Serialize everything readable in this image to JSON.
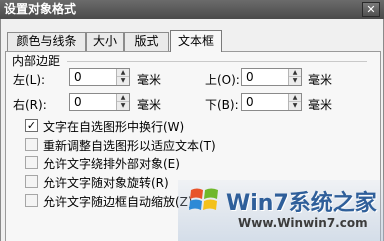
{
  "window": {
    "title": "设置对象格式",
    "close_glyph": "✕"
  },
  "tabs": [
    {
      "label": "颜色与线条",
      "active": false
    },
    {
      "label": "大小",
      "active": false
    },
    {
      "label": "版式",
      "active": false
    },
    {
      "label": "文本框",
      "active": true
    }
  ],
  "internal_margin": {
    "section_title": "内部边距",
    "left": {
      "label": "左(L):",
      "value": "0",
      "unit": "毫米"
    },
    "right": {
      "label": "右(R):",
      "value": "0",
      "unit": "毫米"
    },
    "top": {
      "label": "上(O):",
      "value": "0",
      "unit": "毫米"
    },
    "bottom": {
      "label": "下(B):",
      "value": "0",
      "unit": "毫米"
    }
  },
  "options": [
    {
      "label": "文字在自选图形中换行(W)",
      "checked": true,
      "enabled": true
    },
    {
      "label": "重新调整自选图形以适应文本(T)",
      "checked": false,
      "enabled": false
    },
    {
      "label": "允许文字绕排外部对象(E)",
      "checked": false,
      "enabled": false
    },
    {
      "label": "允许文字随对象旋转(R)",
      "checked": false,
      "enabled": false
    },
    {
      "label": "允许文字随边框自动缩放(Z)",
      "checked": false,
      "enabled": false
    }
  ],
  "watermark": {
    "brand": "Win7系统之家",
    "url": "Www.Winwin7.com"
  },
  "colors": {
    "titlebar": "#555555",
    "logo_text": "#2f5f9a"
  }
}
